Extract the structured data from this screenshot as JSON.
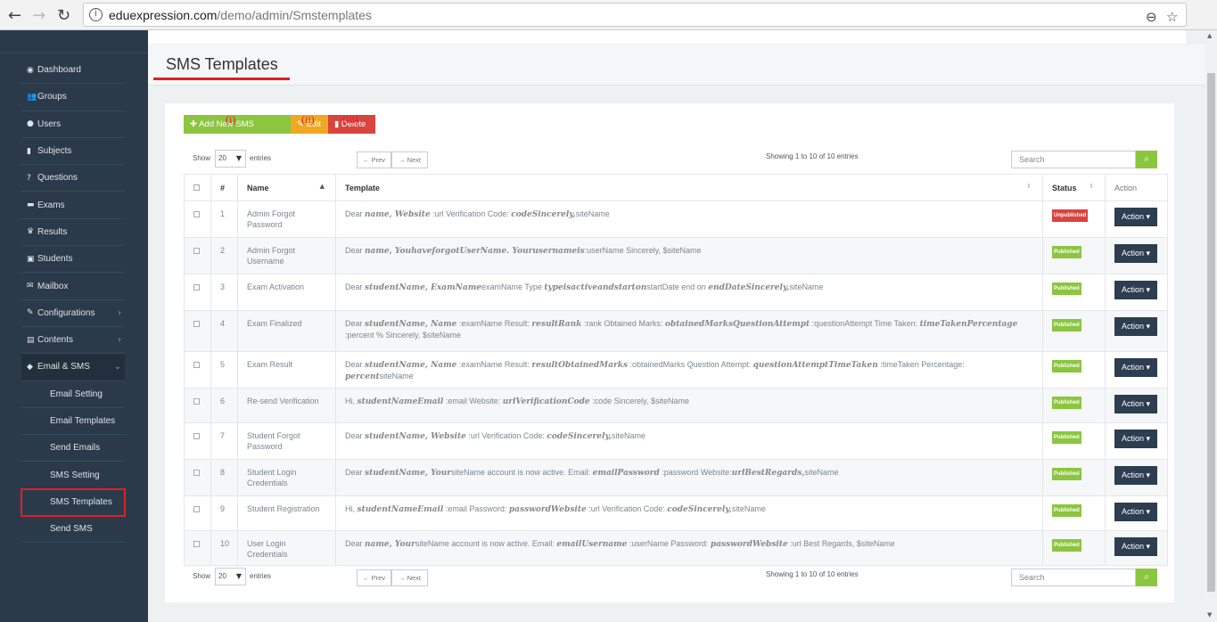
{
  "browser": {
    "url_host": "eduexpression.com",
    "url_path": "/demo/admin/Smstemplates"
  },
  "sidebar": {
    "items": [
      {
        "label": "Dashboard",
        "icon": "dashboard-icon",
        "glyph": "◉"
      },
      {
        "label": "Groups",
        "icon": "groups-icon",
        "glyph": "👥"
      },
      {
        "label": "Users",
        "icon": "user-icon",
        "glyph": "●"
      },
      {
        "label": "Subjects",
        "icon": "book-icon",
        "glyph": "▮"
      },
      {
        "label": "Questions",
        "icon": "question-icon",
        "glyph": "?"
      },
      {
        "label": "Exams",
        "icon": "exam-icon",
        "glyph": "▬"
      },
      {
        "label": "Results",
        "icon": "trophy-icon",
        "glyph": "♛"
      },
      {
        "label": "Students",
        "icon": "students-icon",
        "glyph": "▣"
      },
      {
        "label": "Mailbox",
        "icon": "mailbox-icon",
        "glyph": "✉"
      },
      {
        "label": "Configurations",
        "icon": "wrench-icon",
        "glyph": "✎",
        "arrow": "›"
      },
      {
        "label": "Contents",
        "icon": "contents-icon",
        "glyph": "▤",
        "arrow": "›"
      },
      {
        "label": "Email & SMS",
        "icon": "shield-icon",
        "glyph": "◆",
        "arrow": "⌄"
      }
    ],
    "sub_items": [
      "Email Setting",
      "Email Templates",
      "Send Emails",
      "SMS Setting",
      "SMS Templates",
      "Send SMS"
    ]
  },
  "page": {
    "title": "SMS Templates"
  },
  "toolbar": {
    "add_label": "✚ Add New SMS Template",
    "edit_label": "✎ Edit",
    "delete_label": "▮ Delete",
    "ann_add": "(i)",
    "ann_edit": "(ii)",
    "ann_delete": "(iii)"
  },
  "list_controls": {
    "show_label": "Show",
    "page_size": "20",
    "entries_label": "entries",
    "prev": "← Prev",
    "next": "→ Next",
    "showing": "Showing 1 to 10 of 10 entries",
    "search_placeholder": "Search"
  },
  "table": {
    "headers": {
      "num": "#",
      "name": "Name",
      "template": "Template",
      "status": "Status",
      "action": "Action"
    },
    "action_label": "Action ▾",
    "rows": [
      {
        "num": "1",
        "name": "Admin Forgot Password",
        "status": "Unpublished",
        "tpl": [
          [
            "t",
            "Dear "
          ],
          [
            "b",
            "name, Website"
          ],
          [
            "t",
            " :url Verification Code: "
          ],
          [
            "b",
            "codeSincerely,"
          ],
          [
            "t",
            "siteName"
          ]
        ]
      },
      {
        "num": "2",
        "name": "Admin Forgot Username",
        "status": "Published",
        "tpl": [
          [
            "t",
            "Dear "
          ],
          [
            "b",
            "name, YouhaveforgotUserName. Yourusernameis"
          ],
          [
            "t",
            ":userName Sincerely, $siteName"
          ]
        ]
      },
      {
        "num": "3",
        "name": "Exam Activation",
        "status": "Published",
        "tpl": [
          [
            "t",
            "Dear "
          ],
          [
            "b",
            "studentName, ExamName"
          ],
          [
            "t",
            "examName Type "
          ],
          [
            "b",
            "typeisactiveandstarton"
          ],
          [
            "t",
            "startDate end on "
          ],
          [
            "b",
            "endDateSincerely,"
          ],
          [
            "t",
            "siteName"
          ]
        ]
      },
      {
        "num": "4",
        "name": "Exam Finalized",
        "status": "Published",
        "tpl": [
          [
            "t",
            "Dear "
          ],
          [
            "b",
            "studentName, Name"
          ],
          [
            "t",
            " :examName Result: "
          ],
          [
            "b",
            "resultRank"
          ],
          [
            "t",
            " :rank Obtained Marks: "
          ],
          [
            "b",
            "obtainedMarksQuestionAttempt"
          ],
          [
            "t",
            " :questionAttempt Time Taken: "
          ],
          [
            "b",
            "timeTakenPercentage"
          ],
          [
            "t",
            " :percent % Sincerely, $siteName"
          ]
        ]
      },
      {
        "num": "5",
        "name": "Exam Result",
        "status": "Published",
        "tpl": [
          [
            "t",
            "Dear "
          ],
          [
            "b",
            "studentName, Name"
          ],
          [
            "t",
            " :examName Result: "
          ],
          [
            "b",
            "resultObtainedMarks"
          ],
          [
            "t",
            " :obtainedMarks Question Attempt: "
          ],
          [
            "b",
            "questionAttemptTimeTaken"
          ],
          [
            "t",
            " :timeTaken Percentage: "
          ],
          [
            "b",
            "percent"
          ],
          [
            "t",
            "siteName"
          ]
        ]
      },
      {
        "num": "6",
        "name": "Re-send Verification",
        "status": "Published",
        "tpl": [
          [
            "t",
            "Hi, "
          ],
          [
            "b",
            "studentNameEmail"
          ],
          [
            "t",
            " :email Website: "
          ],
          [
            "b",
            "urlVerificationCode"
          ],
          [
            "t",
            " :code Sincerely, $siteName"
          ]
        ]
      },
      {
        "num": "7",
        "name": "Student Forgot Password",
        "status": "Published",
        "tpl": [
          [
            "t",
            "Dear "
          ],
          [
            "b",
            "studentName, Website"
          ],
          [
            "t",
            " :url Verification Code: "
          ],
          [
            "b",
            "codeSincerely,"
          ],
          [
            "t",
            "siteName"
          ]
        ]
      },
      {
        "num": "8",
        "name": "Student Login Credentials",
        "status": "Published",
        "tpl": [
          [
            "t",
            "Dear "
          ],
          [
            "b",
            "studentName, Your"
          ],
          [
            "t",
            "siteName account is now active. Email: "
          ],
          [
            "b",
            "emailPassword"
          ],
          [
            "t",
            " :password Website:"
          ],
          [
            "b",
            "urlBestRegards,"
          ],
          [
            "t",
            "siteName"
          ]
        ]
      },
      {
        "num": "9",
        "name": "Student Registration",
        "status": "Published",
        "tpl": [
          [
            "t",
            "Hi, "
          ],
          [
            "b",
            "studentNameEmail"
          ],
          [
            "t",
            " :email Password: "
          ],
          [
            "b",
            "passwordWebsite"
          ],
          [
            "t",
            " :url Verification Code: "
          ],
          [
            "b",
            "codeSincerely,"
          ],
          [
            "t",
            "siteName"
          ]
        ]
      },
      {
        "num": "10",
        "name": "User Login Credentials",
        "status": "Published",
        "tpl": [
          [
            "t",
            "Dear "
          ],
          [
            "b",
            "name, Your"
          ],
          [
            "t",
            "siteName account is now active. Email: "
          ],
          [
            "b",
            "emailUsername"
          ],
          [
            "t",
            " :userName Password: "
          ],
          [
            "b",
            "passwordWebsite"
          ],
          [
            "t",
            " :url Best Regards, $siteName"
          ]
        ]
      }
    ]
  },
  "colors": {
    "sidebar_bg": "#2b3a4a",
    "green": "#8cc540",
    "orange": "#f0a821",
    "red": "#d9443e",
    "dark_btn": "#2c3e50"
  }
}
